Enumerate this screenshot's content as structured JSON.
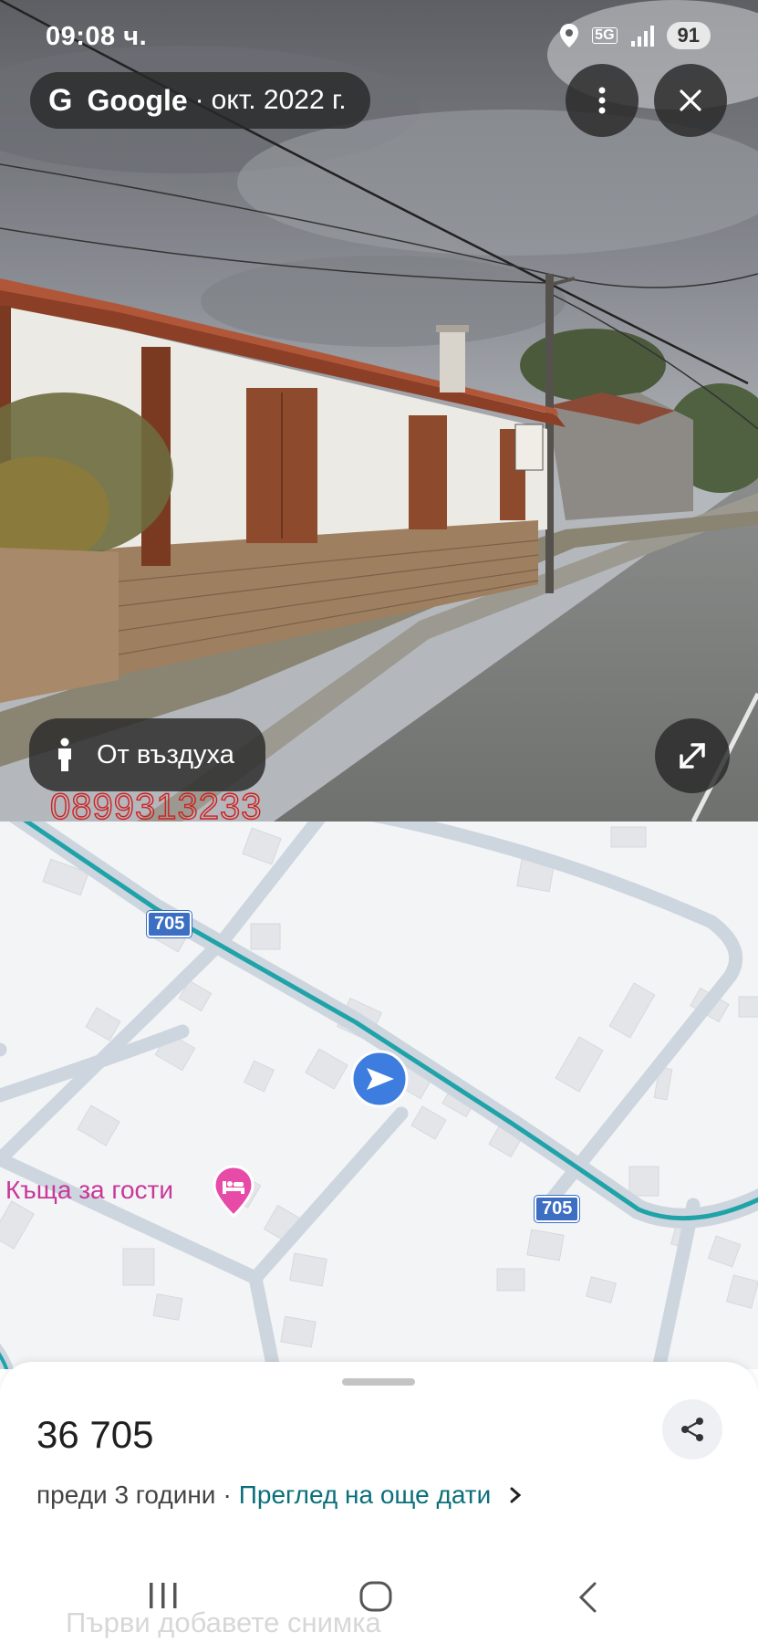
{
  "status_bar": {
    "time": "09:08 ч.",
    "network": "5G",
    "battery": "91"
  },
  "streetview": {
    "provider": "Google",
    "capture_date": "окт. 2022 г.",
    "aerial_button_label": "От въздуха",
    "watermark_text": "0899313233"
  },
  "map": {
    "route_number_1": "705",
    "route_number_2": "705",
    "poi_label": "Къща за гости",
    "colors": {
      "route": "#1fa3a8",
      "road": "#cdd6df",
      "poi": "#c8379a",
      "position": "#3d7de0"
    }
  },
  "sheet": {
    "title": "36 705",
    "date_text": "преди 3 години",
    "separator": "·",
    "more_dates_link": "Преглед на още дати",
    "ghost_text": "Първи добавете снимка"
  },
  "icons": [
    "location-icon",
    "signal-icon",
    "more-vert-icon",
    "close-icon",
    "person-icon",
    "expand-icon",
    "navigation-arrow-icon",
    "bed-icon",
    "share-icon",
    "chevron-right-icon",
    "recents-icon",
    "home-icon",
    "back-icon"
  ]
}
